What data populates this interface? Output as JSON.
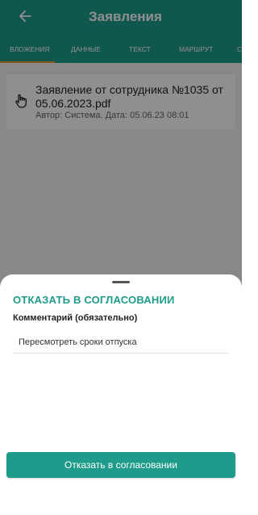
{
  "header": {
    "title": "Заявления",
    "back_icon": "arrow-left-icon"
  },
  "tabs": [
    {
      "label": "ВЛОЖЕНИЯ",
      "active": true
    },
    {
      "label": "ДАННЫЕ",
      "active": false
    },
    {
      "label": "ТЕКСТ",
      "active": false
    },
    {
      "label": "МАРШРУТ",
      "active": false
    },
    {
      "label": "С",
      "active": false
    }
  ],
  "attachment": {
    "title": "Заявление от сотрудника №1035 от 05.06.2023.pdf",
    "meta": "Автор: Система. Дата: 05.06.23 08:01",
    "icon": "hand-pointer-icon"
  },
  "sheet": {
    "title": "ОТКАЗАТЬ В СОГЛАСОВАНИИ",
    "comment_label": "Комментарий (обязательно)",
    "comment_value": "Пересмотреть сроки отпуска",
    "submit_label": "Отказать в согласовании"
  },
  "colors": {
    "primary": "#1e9b8a",
    "tab_indicator": "#ff9c3a"
  }
}
